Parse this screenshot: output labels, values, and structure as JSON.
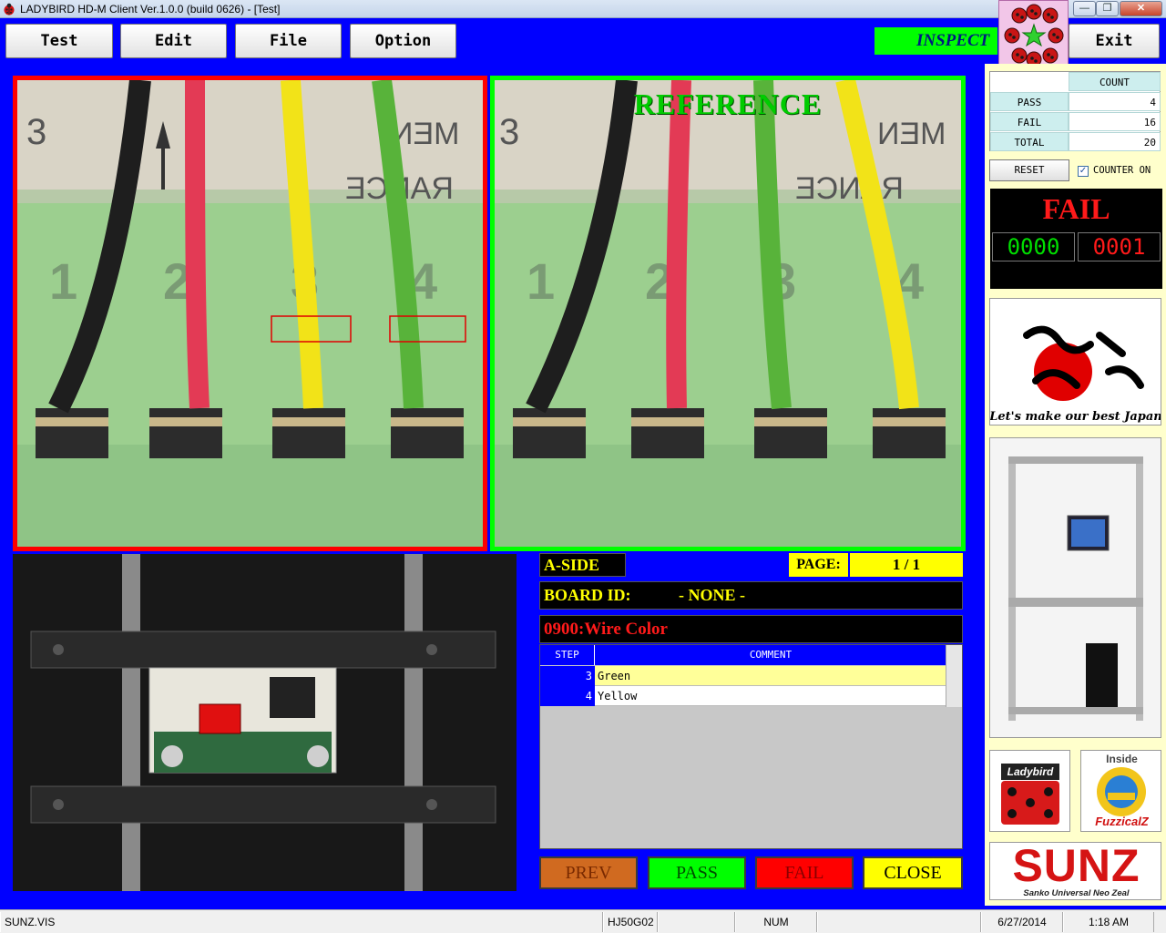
{
  "window": {
    "title": "LADYBIRD HD-M Client Ver.1.0.0  (build 0626) - [Test]",
    "controls": {
      "minimize": "—",
      "maximize": "❐",
      "close": "✕"
    }
  },
  "menu": {
    "test": "Test",
    "edit": "Edit",
    "file": "File",
    "option": "Option",
    "exit": "Exit",
    "mode": "INSPECT"
  },
  "images": {
    "reference_label": "REFERENCE",
    "inspect_border_color": "#ff0000",
    "reference_border_color": "#00ff00",
    "inspect_wires": [
      "black",
      "red",
      "yellow",
      "green"
    ],
    "reference_wires": [
      "black",
      "red",
      "green",
      "yellow"
    ],
    "terminal_labels": [
      "1",
      "2",
      "3",
      "4"
    ]
  },
  "info": {
    "side": "A-SIDE",
    "page_label": "PAGE:",
    "page_value": "1 / 1",
    "board_id_label": "BOARD ID:",
    "board_id_value": "- NONE -",
    "step_name": "0900:Wire Color"
  },
  "steps": {
    "header_step": "STEP",
    "header_comment": "COMMENT",
    "rows": [
      {
        "step": "3",
        "comment": "Green"
      },
      {
        "step": "4",
        "comment": "Yellow"
      }
    ]
  },
  "actions": {
    "prev": "PREV",
    "pass": "PASS",
    "fail": "FAIL",
    "close": "CLOSE"
  },
  "counter": {
    "header": "COUNT",
    "pass_label": "PASS",
    "pass_value": "4",
    "fail_label": "FAIL",
    "fail_value": "16",
    "total_label": "TOTAL",
    "total_value": "20",
    "reset": "RESET",
    "counter_on_label": "COUNTER ON",
    "counter_on_checked": "✓"
  },
  "result": {
    "status": "FAIL",
    "left_counter": "0000",
    "right_counter": "0001"
  },
  "logos": {
    "japan_caption": "Let's make our best Japan",
    "ladybird": "Ladybird",
    "fuzzical_inside": "Inside",
    "fuzzical": "FuzzicalZ",
    "sunz": "SUNZ",
    "sunz_tagline": "Sanko Universal Neo Zeal"
  },
  "statusbar": {
    "file": "SUNZ.VIS",
    "model": "HJ50G02",
    "num": "NUM",
    "date": "6/27/2014",
    "time": "1:18 AM"
  }
}
